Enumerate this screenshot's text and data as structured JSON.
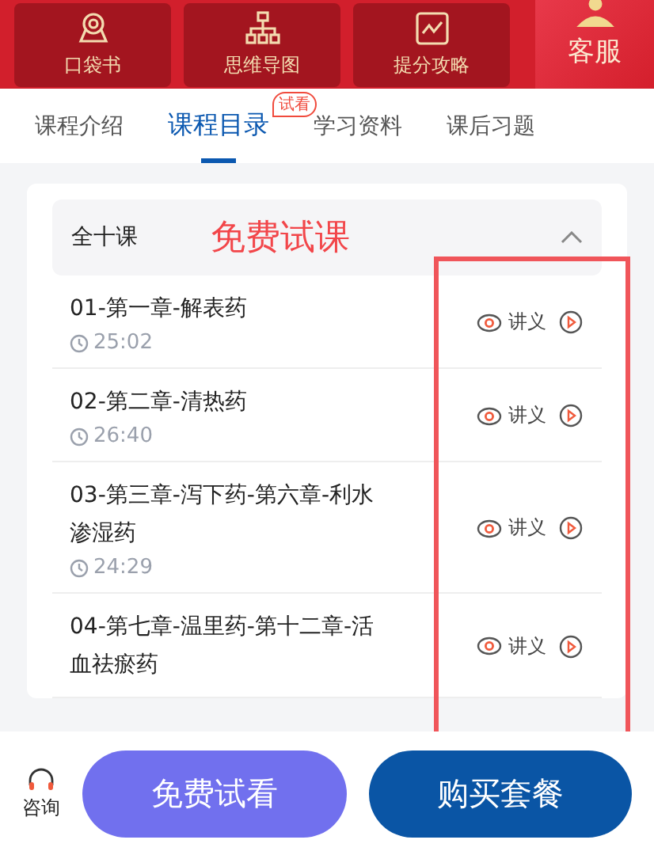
{
  "header": {
    "tools": [
      {
        "label": "口袋书",
        "kind": "badge"
      },
      {
        "label": "思维导图",
        "kind": "tree"
      },
      {
        "label": "提分攻略",
        "kind": "chart"
      }
    ],
    "service": {
      "label": "客服"
    }
  },
  "tabs": [
    {
      "label": "课程介绍",
      "selected": false
    },
    {
      "label": "课程目录",
      "selected": true,
      "badge": "试看"
    },
    {
      "label": "学习资料",
      "selected": false
    },
    {
      "label": "课后习题",
      "selected": false
    }
  ],
  "course": {
    "title": "全十课",
    "annotation": "免费试课",
    "expanded": true,
    "lessons": [
      {
        "title": "01-第一章-解表药",
        "duration": "25:02",
        "notes": "讲义"
      },
      {
        "title": "02-第二章-清热药",
        "duration": "26:40",
        "notes": "讲义"
      },
      {
        "title": "03-第三章-泻下药-第六章-利水渗湿药",
        "duration": "24:29",
        "notes": "讲义"
      },
      {
        "title": "04-第七章-温里药-第十二章-活血祛瘀药",
        "notes": "讲义"
      }
    ]
  },
  "bottom_bar": {
    "consult": "咨询",
    "trial_button": "免费试看",
    "buy_button": "购买套餐"
  }
}
